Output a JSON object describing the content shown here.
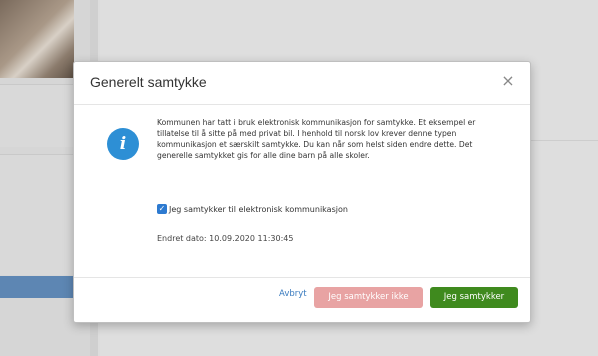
{
  "dialog": {
    "title": "Generelt samtykke",
    "close_symbol": "×",
    "info_icon": "i",
    "body": "Kommunen har tatt i bruk elektronisk kommunikasjon for samtykke. Et eksempel er tillatelse til å sitte på med privat bil. I henhold til norsk lov krever denne typen kommunikasjon et særskilt samtykke. Du kan når som helst siden endre dette. Det generelle samtykket gis for alle dine barn på alle skoler.",
    "checkbox_label": "Jeg samtykker til elektronisk kommunikasjon",
    "checkbox_checked": true,
    "changed_text": "Endret dato: 10.09.2020 11:30:45",
    "cancel_label": "Avbryt",
    "decline_label": "Jeg samtykker ikke",
    "accept_label": "Jeg samtykker"
  },
  "colors": {
    "info_icon": "#2d8fd5",
    "accept_button": "#3f8a1e",
    "decline_button": "#e8a3a3",
    "cancel_link": "#3a7bbf",
    "background_accent": "#5d86b3"
  },
  "icons": {
    "info": "info-icon",
    "close": "close-icon",
    "checkbox": "checkmark-icon"
  }
}
